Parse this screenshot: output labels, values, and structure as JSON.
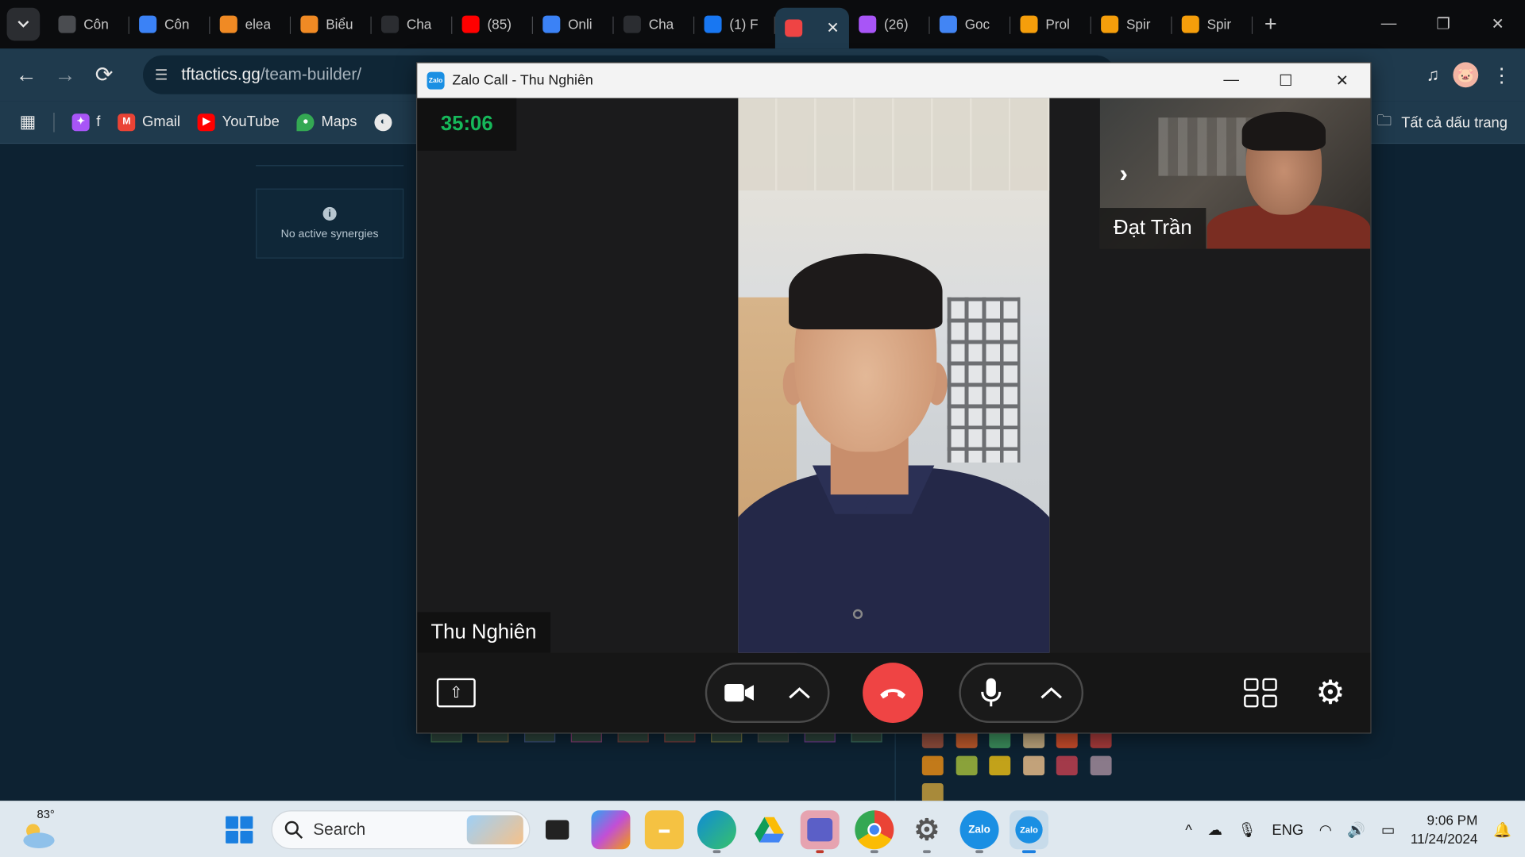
{
  "tabs": [
    {
      "title": "Côn",
      "icon": "globe-icon",
      "color": "#4a4c50"
    },
    {
      "title": "Côn",
      "icon": "google-docs-icon",
      "color": "#3b82f6"
    },
    {
      "title": "elea",
      "icon": "orange-app-icon",
      "color": "#f08a24"
    },
    {
      "title": "Biểu",
      "icon": "orange-app-icon",
      "color": "#f08a24"
    },
    {
      "title": "Cha",
      "icon": "chatgpt-icon",
      "color": "#2b2d31"
    },
    {
      "title": "(85)",
      "icon": "youtube-icon",
      "color": "#ff0000"
    },
    {
      "title": "Onli",
      "icon": "google-docs-icon",
      "color": "#3b82f6"
    },
    {
      "title": "Cha",
      "icon": "chatgpt-icon",
      "color": "#2b2d31"
    },
    {
      "title": "(1) F",
      "icon": "facebook-icon",
      "color": "#1877f2"
    },
    {
      "title": "",
      "icon": "tft-icon",
      "color": "#ef4444",
      "active": true
    },
    {
      "title": "(26)",
      "icon": "messenger-icon",
      "color": "#a855f7"
    },
    {
      "title": "Goc",
      "icon": "google-translate-icon",
      "color": "#4285f4"
    },
    {
      "title": "Prol",
      "icon": "spinbot-icon",
      "color": "#f59e0b"
    },
    {
      "title": "Spir",
      "icon": "spinbot-icon",
      "color": "#f59e0b"
    },
    {
      "title": "Spir",
      "icon": "spinbot-icon",
      "color": "#f59e0b"
    }
  ],
  "toolbar": {
    "url_host": "tftactics.gg",
    "url_path": "/team-builder/"
  },
  "bookmarks": {
    "items": [
      {
        "label": "f",
        "icon": "messenger-icon"
      },
      {
        "label": "Gmail",
        "icon": "gmail-icon"
      },
      {
        "label": "YouTube",
        "icon": "youtube-icon"
      },
      {
        "label": "Maps",
        "icon": "maps-icon"
      },
      {
        "label": "",
        "icon": "globe-icon"
      }
    ],
    "all_bookmarks": "Tất cả dấu trang"
  },
  "page": {
    "synergies_text": "No active synergies"
  },
  "zalo": {
    "title": "Zalo Call - Thu Nghiên",
    "timer": "35:06",
    "main_name": "Thu Nghiên",
    "pip_name": "Đạt Trần",
    "end_color": "#ef4444",
    "timer_color": "#16b85a"
  },
  "taskbar": {
    "weather_temp": "83°",
    "search_placeholder": "Search",
    "language": "ENG",
    "time": "9:06 PM",
    "date": "11/24/2024"
  }
}
